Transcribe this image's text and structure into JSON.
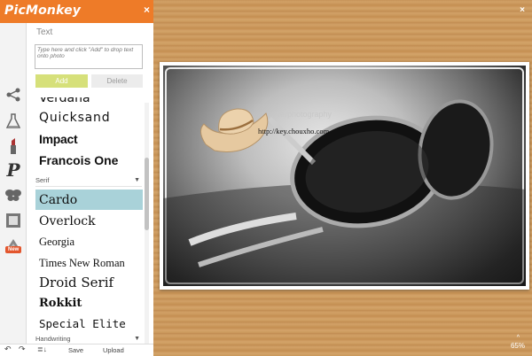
{
  "app": {
    "logo": "PicMonkey",
    "close_symbol": "×"
  },
  "panel": {
    "title": "Text",
    "input_placeholder": "Type here and click \"Add\" to drop text onto photo",
    "add_label": "Add",
    "delete_label": "Delete"
  },
  "fonts": {
    "top_partial": "Verdana",
    "group1": [
      "Quicksand",
      "Impact",
      "Francois One"
    ],
    "serif_category": "Serif",
    "serif": [
      "Cardo",
      "Overlock",
      "Georgia",
      "Times New Roman",
      "Droid Serif",
      "Rokkit",
      "Special Elite"
    ],
    "handwriting_category": "Handwriting",
    "selected": "Cardo"
  },
  "toolbar": {
    "save_label": "Save",
    "upload_label": "Upload"
  },
  "strip": {
    "new_badge": "New"
  },
  "canvas": {
    "close_symbol": "×",
    "zoom": "65%",
    "zoom_caret": "^",
    "watermark": "...verphotography",
    "url_text": "http://key.chouxho.com"
  },
  "colors": {
    "brand": "#ee7b28",
    "selected_row": "#a9d2d9",
    "add_button": "#d6e07a"
  }
}
